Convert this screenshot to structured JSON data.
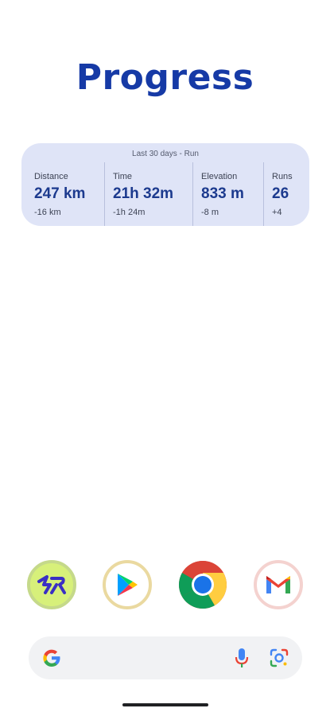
{
  "widget": {
    "title": "Progress",
    "period": "Last 30 days - Run",
    "stats": [
      {
        "label": "Distance",
        "value": "247 km",
        "delta": "-16 km"
      },
      {
        "label": "Time",
        "value": "21h 32m",
        "delta": "-1h 24m"
      },
      {
        "label": "Elevation",
        "value": "833 m",
        "delta": "-8 m"
      },
      {
        "label": "Runs",
        "value": "26",
        "delta": "+4"
      }
    ]
  },
  "dock": {
    "apps": [
      {
        "name": "runner-app-icon"
      },
      {
        "name": "play-store-icon"
      },
      {
        "name": "chrome-icon"
      },
      {
        "name": "gmail-icon"
      }
    ]
  },
  "search": {
    "logo": "google-g-icon",
    "mic": "microphone-icon",
    "lens": "google-lens-icon"
  },
  "colors": {
    "title": "#163aa6",
    "widget_bg": "#dfe4f7",
    "value": "#1c3a8e"
  }
}
